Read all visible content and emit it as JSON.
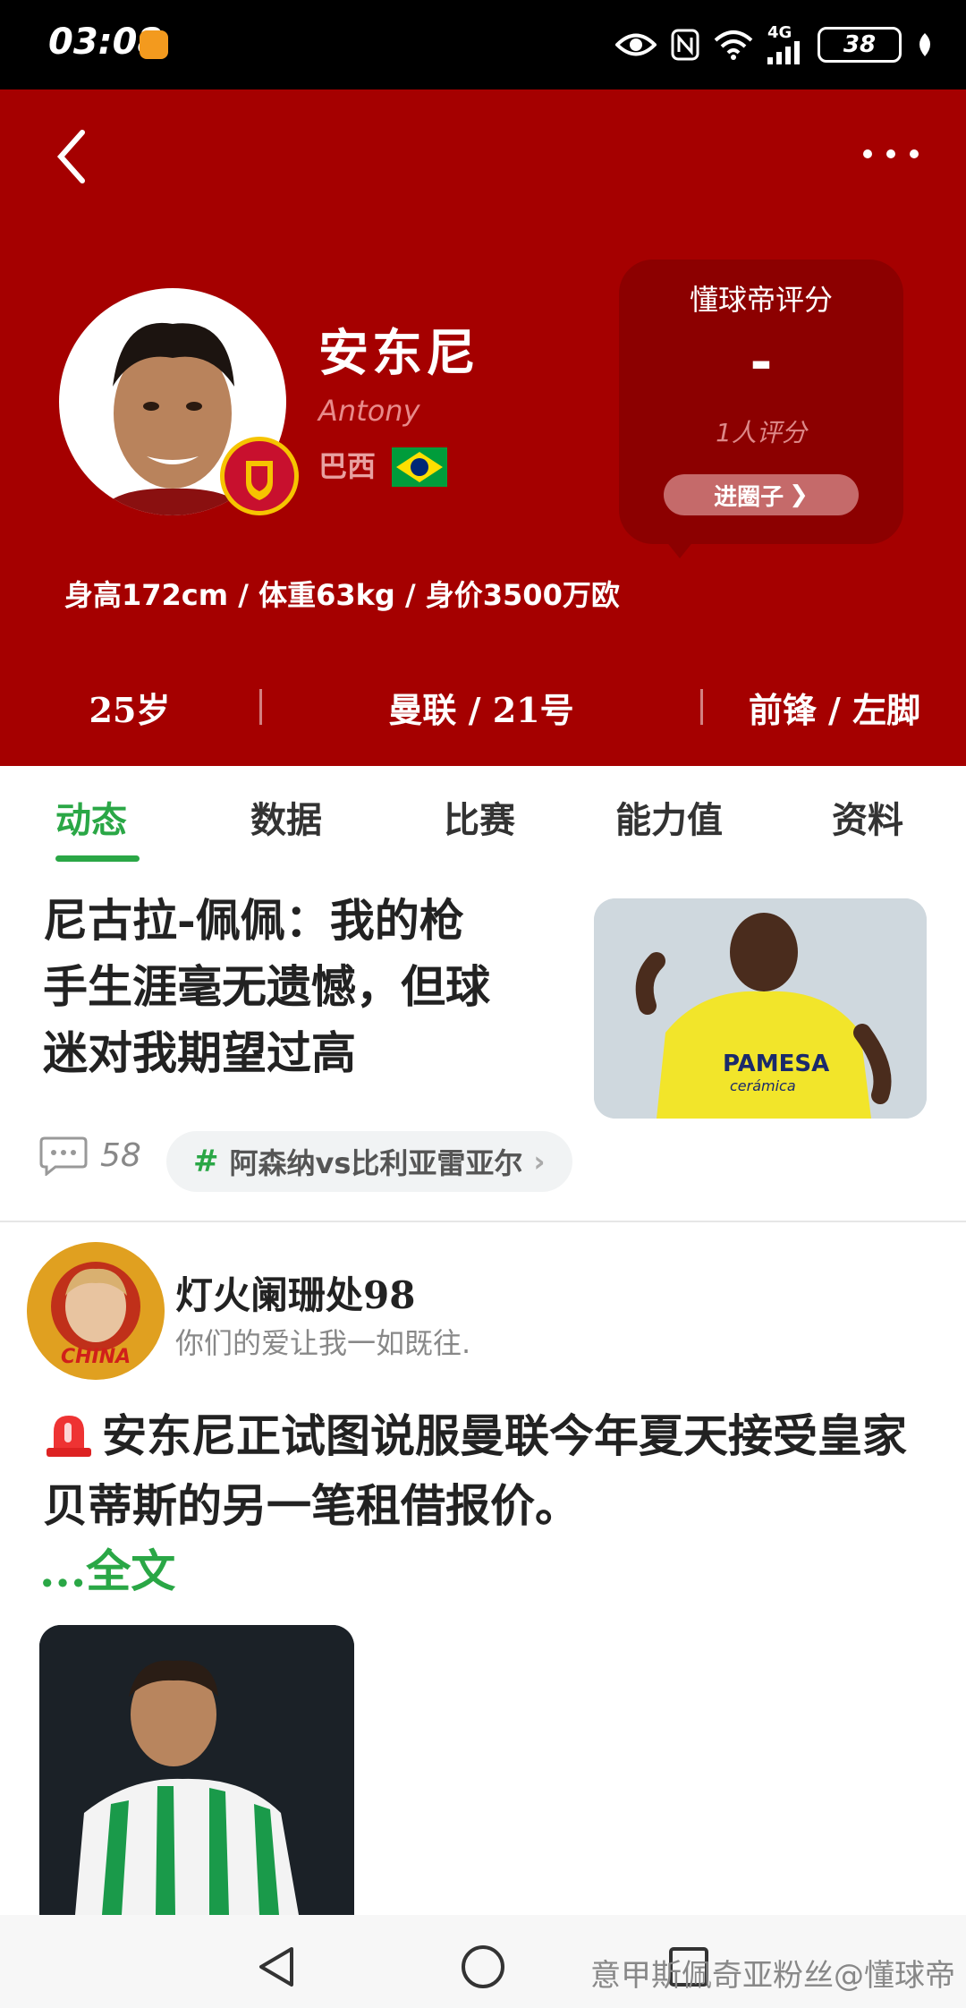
{
  "status_bar": {
    "time": "03:08",
    "network": "4G",
    "battery": "38"
  },
  "player": {
    "name_cn": "安东尼",
    "name_en": "Antony",
    "nationality": "巴西",
    "body_stats": "身高172cm / 体重63kg / 身价3500万欧",
    "age": "25岁",
    "club_number": "曼联 / 21号",
    "position_foot": "前锋 / 左脚"
  },
  "rating": {
    "title": "懂球帝评分",
    "value": "-",
    "count": "1人评分",
    "button_label": "进圈子",
    "button_arrow": "❯"
  },
  "tabs": [
    {
      "label": "动态",
      "active": true
    },
    {
      "label": "数据",
      "active": false
    },
    {
      "label": "比赛",
      "active": false
    },
    {
      "label": "能力值",
      "active": false
    },
    {
      "label": "资料",
      "active": false
    }
  ],
  "news": {
    "title_lines": [
      "尼古拉-佩佩：我的枪",
      "手生涯毫无遗憾，但球",
      "迷对我期望过高"
    ],
    "thumb_sponsor": "PAMESA",
    "thumb_sponsor_sub": "cerámica",
    "comment_count": "58",
    "topic_hash": "#",
    "topic_label": "阿森纳vs比利亚雷亚尔",
    "topic_arrow": "›"
  },
  "post": {
    "username": "灯火阑珊处98",
    "signature": "你们的爱让我一如既往.",
    "text": "安东尼正试图说服曼联今年夏天接受皇家贝蒂斯的另一笔租借报价。",
    "read_more": "...全文",
    "avatar_badge": "CHINA"
  },
  "watermark": "意甲斯佩奇亚粉丝@懂球帝",
  "colors": {
    "header_red": "#a50000",
    "card_red": "#8c0000",
    "accent_green": "#2aa746"
  }
}
